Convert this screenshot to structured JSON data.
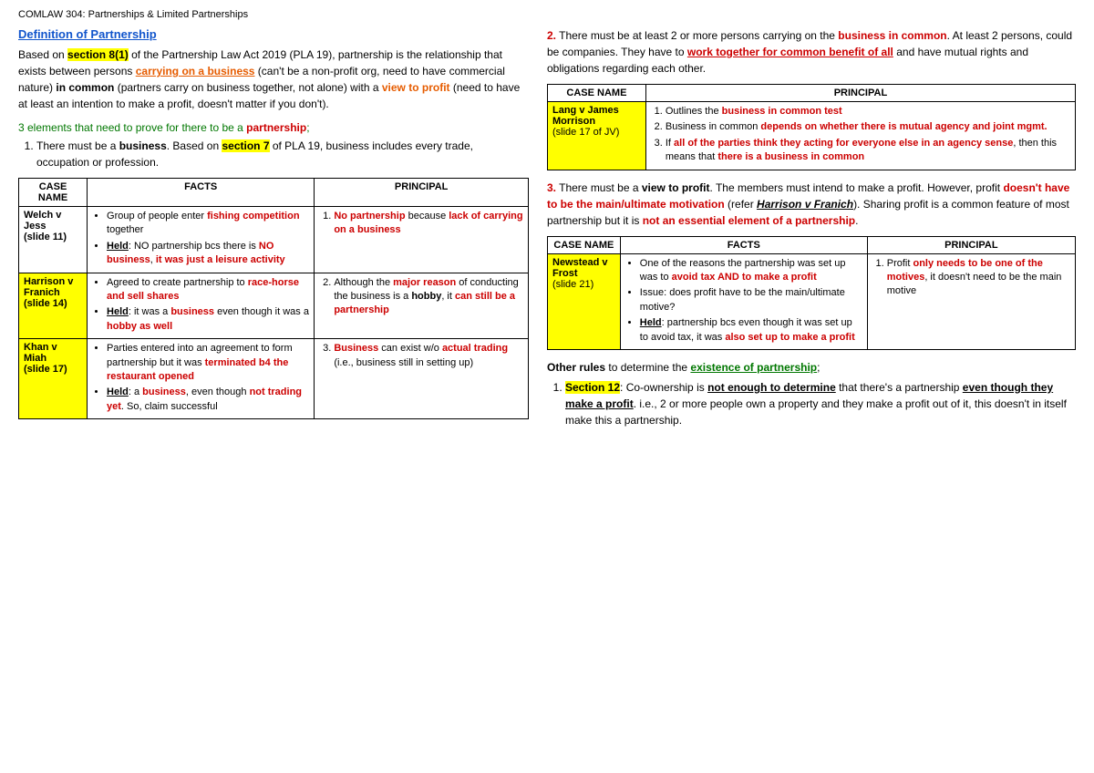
{
  "pageTitle": "COMLAW 304: Partnerships & Limited Partnerships",
  "leftCol": {
    "sectionTitle": "Definition of Partnership",
    "introText": {
      "part1": "Based on ",
      "section": "section 8(1)",
      "part2": " of the Partnership Law Act 2019 (PLA 19), partnership is the relationship that exists between persons ",
      "carryingBusiness": "carrying on a business",
      "part3": " (can't be a non-profit org, need to have commercial nature) ",
      "inCommon": "in common",
      "part4": " (partners carry on business together, not alone) with a ",
      "viewToProfit": "view to profit",
      "part5": " (need to have at least an intention to make a profit, doesn't matter if you don't)."
    },
    "elementsText": "3 elements that need to prove for there to be a ",
    "partnershipWord": "partnership",
    "element1": {
      "text1": "There must be a ",
      "business1": "business",
      "text2": ". Based on ",
      "section7": "section 7",
      "text3": " of PLA 19, business includes every trade, occupation or profession."
    },
    "table": {
      "headers": [
        "CASE NAME",
        "FACTS",
        "PRINCIPAL"
      ],
      "rows": [
        {
          "caseName": "Welch v Jess (slide 11)",
          "caseHighlight": false,
          "facts": [
            "Group of people enter ",
            "fishing competition",
            " together",
            "Held",
            ": NO partnership bcs there is ",
            "NO business",
            ", it was just a ",
            "leisure activity"
          ],
          "principal": [
            "No partnership",
            " because ",
            "lack of carrying on a business"
          ]
        },
        {
          "caseName": "Harrison v Franich (slide 14)",
          "caseHighlight": true,
          "facts": [
            "Agreed to create partnership to ",
            "race-horse and sell shares",
            "Held",
            ": it was a ",
            "business",
            " even though it was a ",
            "hobby as well"
          ],
          "principal": [
            "Although the ",
            "major reason",
            " of conducting the business is a ",
            "hobby",
            ", it ",
            "can still be a partnership"
          ]
        },
        {
          "caseName": "Khan v Miah (slide 17)",
          "caseHighlight": true,
          "facts": [
            "Parties entered into an agreement to form partnership but it was ",
            "terminated b4 the restaurant opened",
            "Held",
            ": a ",
            "business",
            ", even though ",
            "not trading yet",
            ". So, claim successful"
          ],
          "principal": [
            "Business",
            " can exist w/o ",
            "actual trading",
            " (i.e., business still in setting up)"
          ]
        }
      ]
    }
  },
  "rightCol": {
    "point2": {
      "num": "2.",
      "text1": "There must be at least 2 or more persons carrying on the ",
      "businessInCommon": "business in common",
      "text2": ". At least 2 persons, could be companies. They have to ",
      "workTogether": "work together for common benefit of all",
      "text3": " and have mutual rights and obligations regarding each other."
    },
    "table2": {
      "headers": [
        "CASE NAME",
        "PRINCIPAL"
      ],
      "rows": [
        {
          "caseName": "Lang v James Morrison",
          "subtext": "(slide 17 of JV)",
          "caseHighlight": true,
          "principal": [
            {
              "num": "1)",
              "text1": "Outlines the ",
              "highlight": "business in common test",
              "rest": ""
            },
            {
              "num": "2)",
              "text1": "Business in common ",
              "highlight": "depends on whether there is mutual agency and joint mgmt.",
              "rest": ""
            },
            {
              "num": "3)",
              "text1": "If ",
              "highlight": "all of the parties think they acting for everyone else in an agency sense",
              "rest": ", then this means that ",
              "highlight2": "there is a business in common"
            }
          ]
        }
      ]
    },
    "point3": {
      "num": "3.",
      "text1": "There must be a ",
      "viewToProfit": "view to profit",
      "text2": ". The members must intend to make a profit. However, profit ",
      "doesntHave": "doesn't have to be the main/ultimate motivation",
      "text3": " (refer ",
      "harrison": "Harrison v Franich",
      "text4": "). Sharing profit is a common feature of most partnership but it is ",
      "notEssential": "not an essential element of a partnership",
      "text5": "."
    },
    "table3": {
      "headers": [
        "CASE NAME",
        "FACTS",
        "PRINCIPAL"
      ],
      "rows": [
        {
          "caseName": "Newstead v Frost",
          "subtext": "(slide 21)",
          "caseHighlight": true,
          "facts": [
            "One of the reasons the partnership was set up was to ",
            "avoid tax AND to make a profit",
            "Issue: does profit have to be the main/ultimate motive?",
            "Held",
            ": partnership bcs even though it was set up to avoid tax, it was ",
            "also set up to make a profit"
          ],
          "principal": [
            "Profit ",
            "only needs to be one of the motives",
            ", it doesn't need to be the main motive"
          ]
        }
      ]
    },
    "otherRules": {
      "text1": "Other rules",
      "text2": " to determine the ",
      "existence": "existence of partnership",
      "text3": ";",
      "item1": {
        "num": "1.",
        "section12": "Section 12",
        "text1": ": Co-ownership is ",
        "notEnough": "not enough to determine",
        "text2": " that there's a partnership ",
        "evenThough": "even though they make a profit",
        "text3": ". i.e., 2 or more people own a property and they make a profit out of it, this doesn't in itself make this a partnership."
      }
    }
  }
}
